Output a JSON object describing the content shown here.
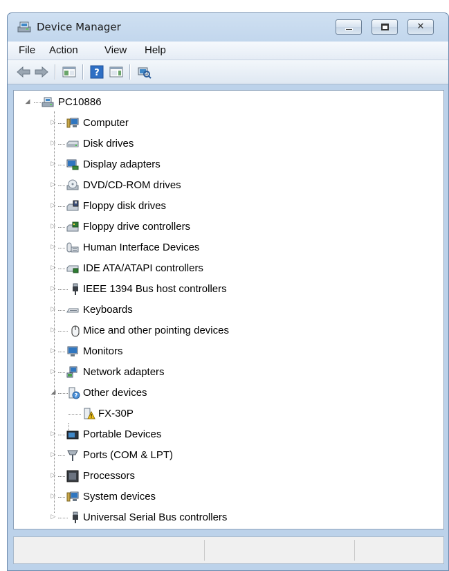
{
  "window": {
    "title": "Device Manager",
    "title_icon": "device-manager-icon",
    "controls": {
      "minimize_icon": "minimize-icon",
      "maximize_icon": "maximize-icon",
      "close_icon": "close-icon",
      "close_glyph": "✕"
    }
  },
  "menu": [
    "File",
    "Action",
    "View",
    "Help"
  ],
  "toolbar": {
    "items": [
      "back-arrow-icon",
      "forward-arrow-icon",
      "show-hide-console-tree-icon",
      "help-icon",
      "show-action-pane-icon",
      "scan-hardware-icon"
    ]
  },
  "tree": {
    "root": {
      "label": "PC10886",
      "icon": "computer-network-icon",
      "expanded": true
    },
    "items": [
      {
        "label": "Computer",
        "icon": "computer-icon",
        "expanded": false
      },
      {
        "label": "Disk drives",
        "icon": "disk-drive-icon",
        "expanded": false
      },
      {
        "label": "Display adapters",
        "icon": "display-adapter-icon",
        "expanded": false
      },
      {
        "label": "DVD/CD-ROM drives",
        "icon": "dvd-drive-icon",
        "expanded": false
      },
      {
        "label": "Floppy disk drives",
        "icon": "floppy-drive-icon",
        "expanded": false
      },
      {
        "label": "Floppy drive controllers",
        "icon": "floppy-controller-icon",
        "expanded": false
      },
      {
        "label": "Human Interface Devices",
        "icon": "hid-icon",
        "expanded": false
      },
      {
        "label": "IDE ATA/ATAPI controllers",
        "icon": "ide-controller-icon",
        "expanded": false
      },
      {
        "label": "IEEE 1394 Bus host controllers",
        "icon": "ieee1394-icon",
        "expanded": false
      },
      {
        "label": "Keyboards",
        "icon": "keyboard-icon",
        "expanded": false
      },
      {
        "label": "Mice and other pointing devices",
        "icon": "mouse-icon",
        "expanded": false
      },
      {
        "label": "Monitors",
        "icon": "monitor-icon",
        "expanded": false
      },
      {
        "label": "Network adapters",
        "icon": "network-adapter-icon",
        "expanded": false
      },
      {
        "label": "Other devices",
        "icon": "unknown-device-icon",
        "expanded": true
      },
      {
        "label": "FX-30P",
        "icon": "warning-device-icon",
        "child": true
      },
      {
        "label": "Portable Devices",
        "icon": "portable-device-icon",
        "expanded": false
      },
      {
        "label": "Ports (COM & LPT)",
        "icon": "port-icon",
        "expanded": false
      },
      {
        "label": "Processors",
        "icon": "processor-icon",
        "expanded": false
      },
      {
        "label": "System devices",
        "icon": "system-device-icon",
        "expanded": false
      },
      {
        "label": "Universal Serial Bus controllers",
        "icon": "usb-icon",
        "expanded": false
      }
    ]
  },
  "statusbar": {
    "cells": [
      "",
      "",
      ""
    ]
  },
  "colors": {
    "titlebar": "#bcd2ea",
    "border": "#6d8bae",
    "tree_bg": "#ffffff",
    "status_bg": "#f0f0f0"
  }
}
